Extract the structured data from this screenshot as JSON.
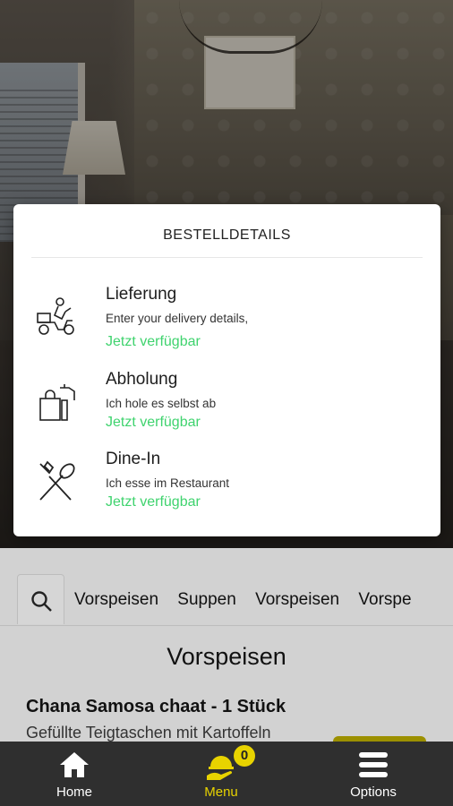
{
  "modal": {
    "title": "BESTELLDETAILS",
    "options": [
      {
        "icon": "delivery-scooter-icon",
        "title": "Lieferung",
        "subtitle": "Enter your delivery details,",
        "status": "Jetzt verfügbar"
      },
      {
        "icon": "pickup-bag-icon",
        "title": "Abholung",
        "subtitle": "Ich hole es selbst ab",
        "status": "Jetzt verfügbar"
      },
      {
        "icon": "fork-spoon-icon",
        "title": "Dine-In",
        "subtitle": "Ich esse im Restaurant",
        "status": "Jetzt verfügbar"
      }
    ]
  },
  "categories": [
    "Vorspeisen",
    "Suppen",
    "Vorspeisen",
    "Vorspe"
  ],
  "section": {
    "title": "Vorspeisen"
  },
  "item": {
    "name": "Chana Samosa chaat - 1 Stück",
    "description": "Gefüllte Teigtaschen mit Kartoffeln"
  },
  "nav": {
    "home_label": "Home",
    "menu_label": "Menu",
    "options_label": "Options",
    "cart_count": "0"
  },
  "colors": {
    "accent": "#e8d300",
    "available": "#3fd36e",
    "nav_bg": "#2f2f2f"
  }
}
